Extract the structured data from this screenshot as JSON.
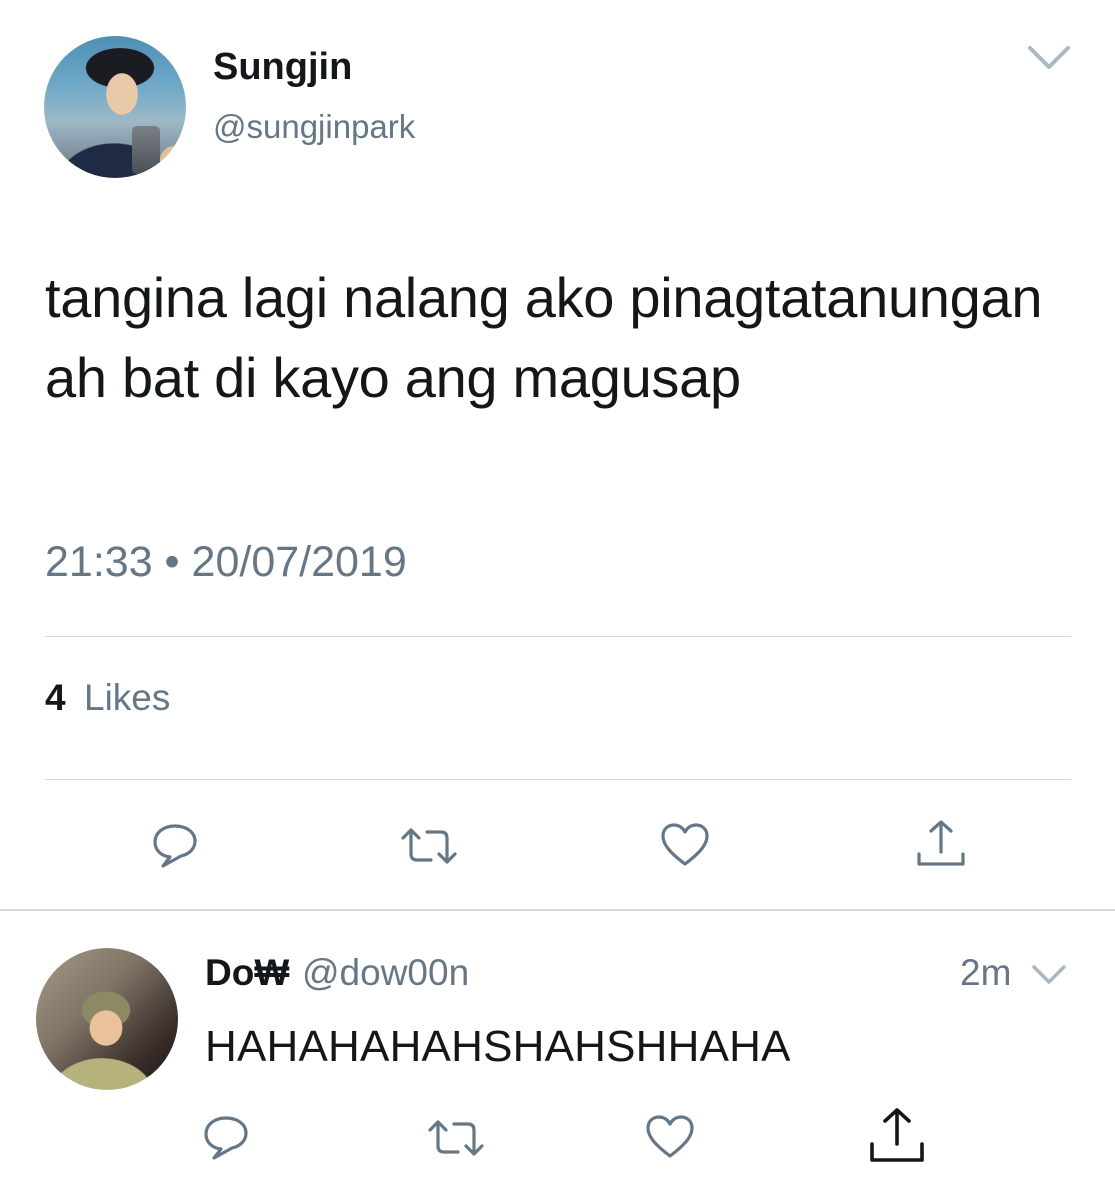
{
  "main_tweet": {
    "author_name": "Sungjin",
    "author_handle": "@sungjinpark",
    "text": "tangina lagi nalang ako pinagtatanungan ah bat di kayo ang magusap",
    "timestamp": "21:33 • 20/07/2019",
    "likes_count": "4",
    "likes_label": "Likes",
    "icons": {
      "menu": "chevron-down-icon",
      "reply": "reply-icon",
      "retweet": "retweet-icon",
      "like": "heart-icon",
      "share": "share-icon"
    }
  },
  "reply_tweet": {
    "author_name": "Do₩",
    "author_handle": "@dow00n",
    "time": "2m",
    "text": "HAHAHAHAHSHAHSHHAHA",
    "icons": {
      "menu": "chevron-down-icon",
      "reply": "reply-icon",
      "retweet": "retweet-icon",
      "like": "heart-icon",
      "share": "share-icon"
    }
  },
  "colors": {
    "text_primary": "#14171a",
    "text_secondary": "#657786",
    "icon": "#657786",
    "divider": "#d4d9dd"
  }
}
